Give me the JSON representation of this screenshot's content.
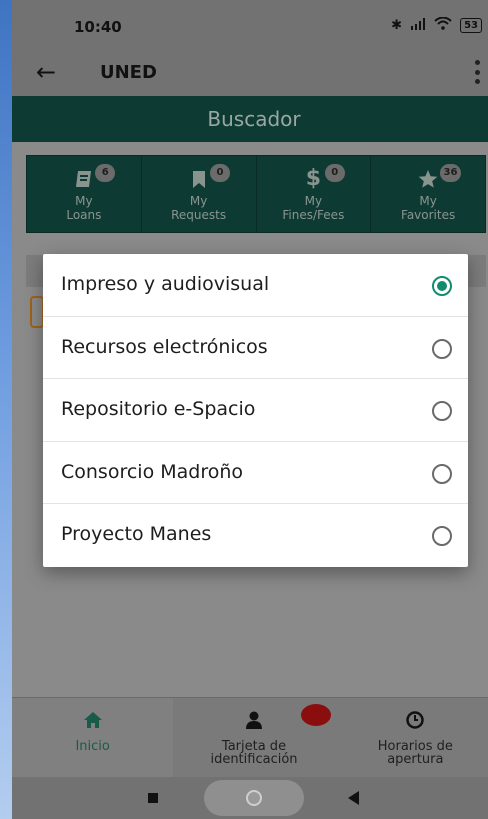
{
  "status_bar": {
    "time": "10:40",
    "battery": "53"
  },
  "app_bar": {
    "title": "UNED"
  },
  "search_header": {
    "title": "Buscador"
  },
  "tiles": [
    {
      "line1": "My",
      "line2": "Loans",
      "badge": "6",
      "icon": "book-icon"
    },
    {
      "line1": "My",
      "line2": "Requests",
      "badge": "0",
      "icon": "bookmark-icon"
    },
    {
      "line1": "My",
      "line2": "Fines/Fees",
      "badge": "0",
      "icon": "dollar-icon"
    },
    {
      "line1": "My",
      "line2": "Favorites",
      "badge": "36",
      "icon": "star-icon"
    }
  ],
  "dialog": {
    "options": [
      {
        "label": "Impreso y audiovisual",
        "selected": true
      },
      {
        "label": "Recursos electrónicos",
        "selected": false
      },
      {
        "label": "Repositorio e-Spacio",
        "selected": false
      },
      {
        "label": "Consorcio Madroño",
        "selected": false
      },
      {
        "label": "Proyecto Manes",
        "selected": false
      }
    ]
  },
  "bottom_nav": [
    {
      "line1": "Inicio",
      "line2": "",
      "icon": "home-icon",
      "active": true
    },
    {
      "line1": "Tarjeta de",
      "line2": "identificación",
      "icon": "person-icon",
      "active": false
    },
    {
      "line1": "Horarios de",
      "line2": "apertura",
      "icon": "clock-icon",
      "active": false
    }
  ],
  "colors": {
    "accent": "#138b6f",
    "header_bg": "#0d3b33",
    "notification": "#8a0e0e"
  }
}
